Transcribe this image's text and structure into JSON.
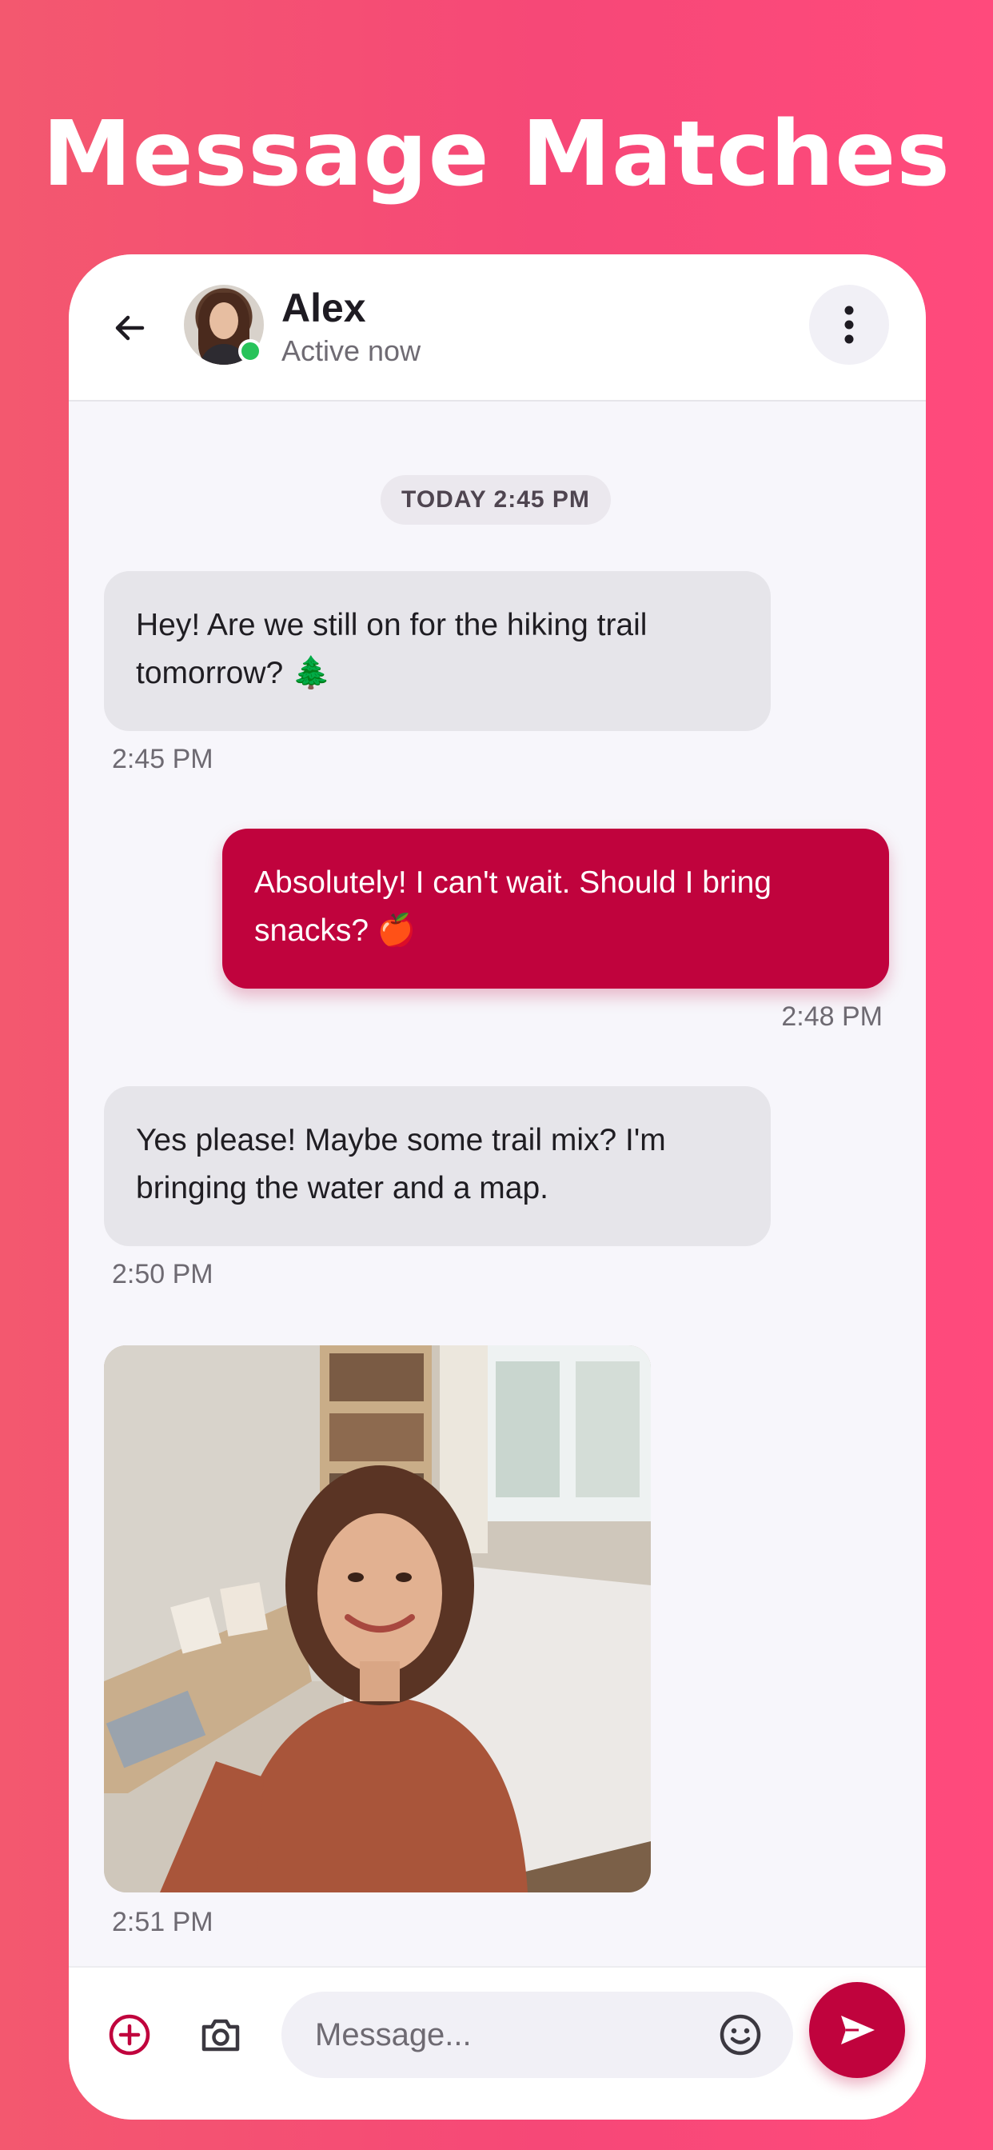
{
  "banner": {
    "headline": "Message Matches"
  },
  "header": {
    "contact_name": "Alex",
    "contact_status": "Active now"
  },
  "chat": {
    "date_separator": "TODAY 2:45 PM",
    "messages": [
      {
        "direction": "incoming",
        "text": "Hey! Are we still on for the hiking trail tomorrow? 🌲",
        "time": "2:45 PM"
      },
      {
        "direction": "outgoing",
        "text": "Absolutely! I can't wait. Should I bring snacks? 🍎",
        "time": "2:48 PM"
      },
      {
        "direction": "incoming",
        "text": "Yes please! Maybe some trail mix? I'm bringing the water and a map.",
        "time": "2:50 PM"
      },
      {
        "direction": "incoming",
        "type": "image",
        "time": "2:51 PM"
      }
    ]
  },
  "composer": {
    "placeholder": "Message..."
  },
  "colors": {
    "accent": "#c0033d",
    "online": "#28c35a",
    "incoming_bubble": "#e6e5ea"
  },
  "icons": {
    "back": "arrow-left-icon",
    "menu": "more-vertical-icon",
    "add": "plus-circle-icon",
    "camera": "camera-icon",
    "emoji": "smile-icon",
    "send": "send-icon"
  }
}
